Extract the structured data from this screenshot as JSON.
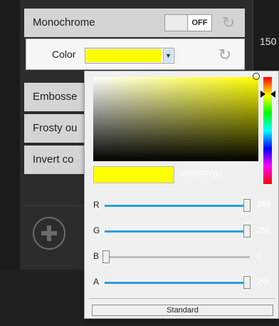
{
  "side_value": "150",
  "rows": {
    "monochrome": {
      "label": "Monochrome",
      "toggle_text": "OFF"
    },
    "color": {
      "label": "Color",
      "swatch_color": "#FFFF00"
    },
    "emboss": {
      "label": "Embosse"
    },
    "frosty": {
      "label": "Frosty ou"
    },
    "invert": {
      "label": "Invert co"
    }
  },
  "picker": {
    "selected_color": "#FFFF00",
    "hex_value": "#FFFFFF00",
    "sliders": [
      {
        "channel": "R",
        "value": "255",
        "fraction": 1.0
      },
      {
        "channel": "G",
        "value": "255",
        "fraction": 1.0
      },
      {
        "channel": "B",
        "value": "0",
        "fraction": 0.0
      },
      {
        "channel": "A",
        "value": "255",
        "fraction": 1.0
      }
    ],
    "standard_label": "Standard"
  }
}
